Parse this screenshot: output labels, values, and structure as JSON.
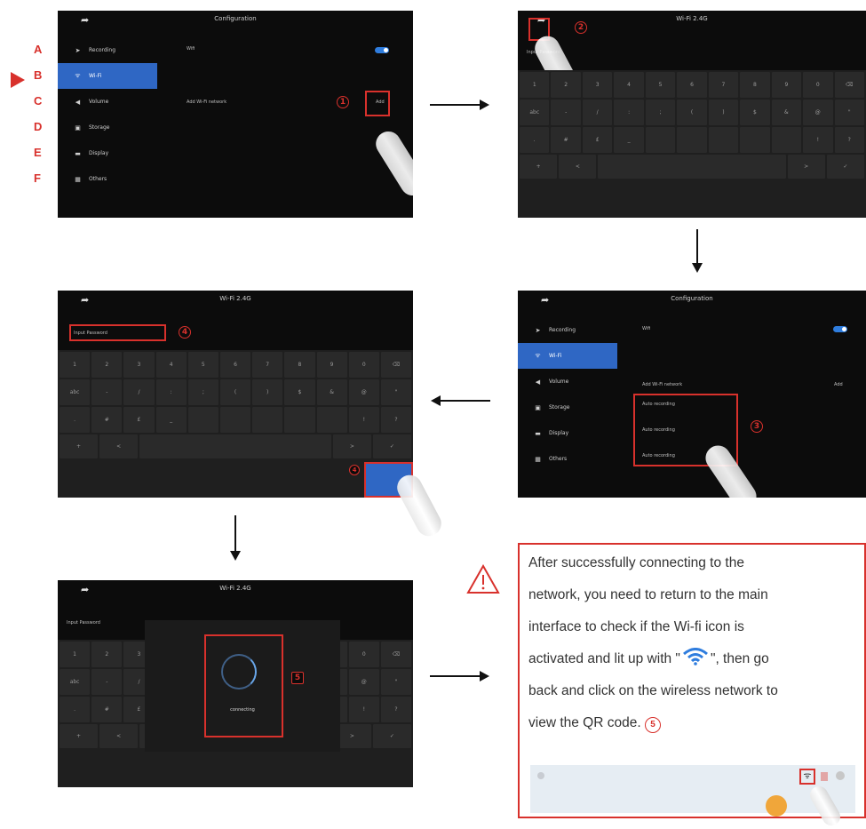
{
  "screen1": {
    "title": "Configuration",
    "menu": [
      {
        "letter": "A",
        "label": "Recording",
        "icon": "recording-icon",
        "glyph": "➤"
      },
      {
        "letter": "B",
        "label": "Wi-Fi",
        "icon": "wifi-icon",
        "glyph": "ᯤ"
      },
      {
        "letter": "C",
        "label": "Volume",
        "icon": "volume-icon",
        "glyph": "◀"
      },
      {
        "letter": "D",
        "label": "Storage",
        "icon": "storage-icon",
        "glyph": "▣"
      },
      {
        "letter": "E",
        "label": "Display",
        "icon": "display-icon",
        "glyph": "▬"
      },
      {
        "letter": "F",
        "label": "Others",
        "icon": "others-icon",
        "glyph": "▦"
      }
    ],
    "wifi_label": "Wifi",
    "add_label": "Add Wi-Fi network",
    "add_button": "Add",
    "step": "1"
  },
  "screen2": {
    "title": "Wi-Fi 2.4G",
    "step": "2",
    "placeholder": "Input Password"
  },
  "screen3": {
    "title": "Configuration",
    "add_label": "Add Wi-Fi network",
    "add_button": "Add",
    "networks": [
      "Auto recording",
      "Auto recording",
      "Auto recording"
    ],
    "step": "3"
  },
  "screen4": {
    "title": "Wi-Fi 2.4G",
    "placeholder": "Input Password",
    "step": "4",
    "confirm_step": "4"
  },
  "screen5": {
    "title": "Wi-Fi 2.4G",
    "placeholder": "Input Password",
    "connecting": "connecting",
    "step": "5"
  },
  "keyboard": {
    "row1": [
      "1",
      "2",
      "3",
      "4",
      "5",
      "6",
      "7",
      "8",
      "9",
      "0",
      "⌫"
    ],
    "row2": [
      "abc",
      "-",
      "/",
      ":",
      ";",
      "(",
      ")",
      "$",
      "&",
      "@",
      "\""
    ],
    "row3": [
      ".",
      "#",
      "£",
      "_",
      "",
      "",
      "",
      "",
      "",
      "!",
      "?"
    ],
    "bottom": [
      "+",
      "<",
      "",
      ">",
      "✓"
    ]
  },
  "note": {
    "lines": [
      "After successfully connecting to the",
      "network, you need to return to the main",
      "interface to check if the Wi-fi icon is"
    ],
    "line4_pre": "activated and lit up with \"",
    "line4_post": "\", then go",
    "line5": "back and click on the wireless network to",
    "line6": "view the QR code.",
    "step": "5",
    "colors": {
      "accent": "#d8312c",
      "wifi": "#2f7dde"
    }
  }
}
